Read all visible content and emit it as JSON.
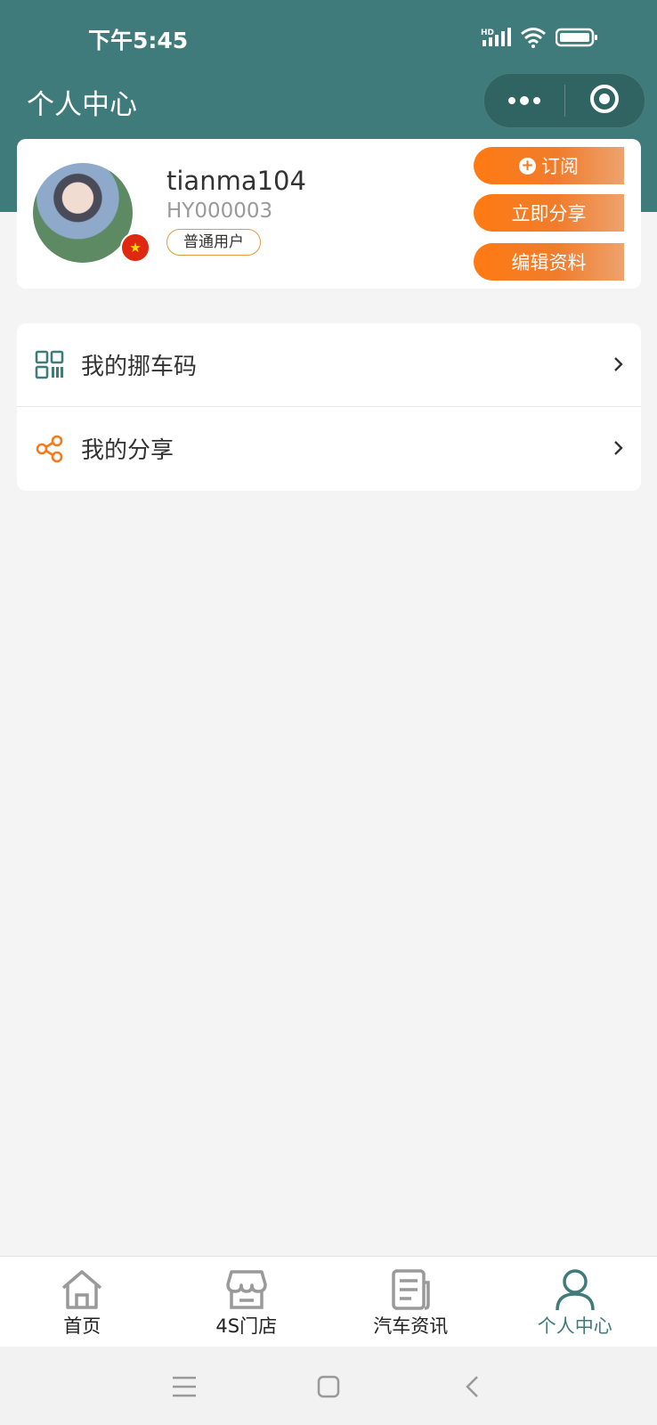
{
  "status_bar": {
    "time": "下午5:45",
    "network": "HD"
  },
  "nav": {
    "title": "个人中心",
    "more_icon": "more-dots-icon",
    "close_icon": "target-icon"
  },
  "profile": {
    "username": "tianma104",
    "user_id": "HY000003",
    "role": "普通用户",
    "buttons": {
      "subscribe": "订阅",
      "share_now": "立即分享",
      "edit_profile": "编辑资料"
    }
  },
  "menu": {
    "items": [
      {
        "label": "我的挪车码",
        "icon": "qr-code-icon"
      },
      {
        "label": "我的分享",
        "icon": "share-nodes-icon"
      }
    ]
  },
  "tabbar": {
    "active": 3,
    "tabs": [
      {
        "label": "首页",
        "icon": "home-icon"
      },
      {
        "label": "4S门店",
        "icon": "store-icon"
      },
      {
        "label": "汽车资讯",
        "icon": "news-icon"
      },
      {
        "label": "个人中心",
        "icon": "user-icon"
      }
    ]
  },
  "colors": {
    "brand_teal": "#3f7b7a",
    "accent_orange": "#f57a1c"
  }
}
